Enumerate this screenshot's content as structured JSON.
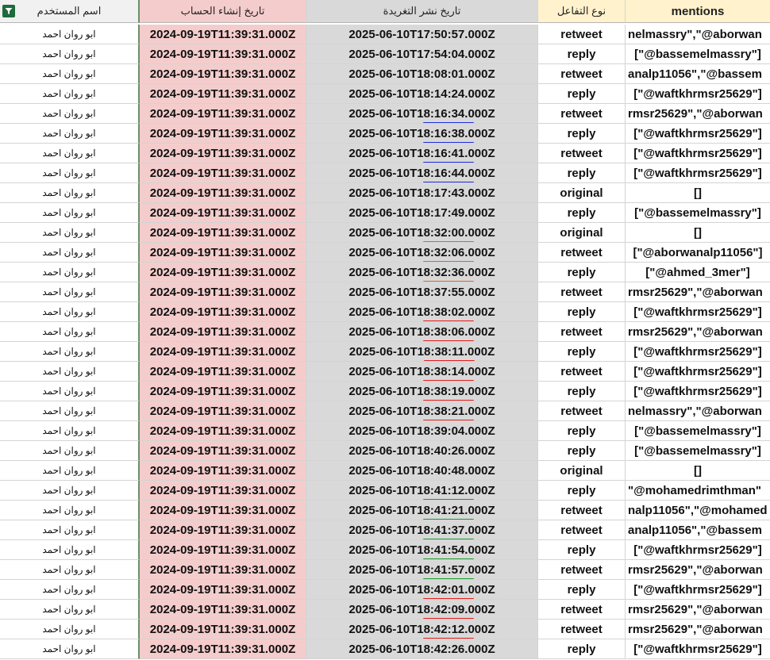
{
  "columns": {
    "user": "اسم المستخدم",
    "created": "تاريخ إنشاء الحساب",
    "published": "تاريخ نشر التغريدة",
    "type": "نوع التفاعل",
    "mentions": "mentions"
  },
  "icons": {
    "filter": "filter-icon"
  },
  "colors": {
    "created_bg": "#f4cccc",
    "published_bg": "#d9d9d9",
    "header_yellow": "#fff2cc",
    "underline_blue": "#1d2ce0",
    "underline_orange": "#f0620f",
    "underline_red": "#e81c1c",
    "underline_green": "#1a9a2a"
  },
  "rows": [
    {
      "user": "ابو روان احمد",
      "created": "2024-09-19T11:39:31.000Z",
      "published": "2025-06-10T17:50:57.000Z",
      "type": "retweet",
      "mentions": "nelmassry\",\"@aborwan",
      "underline": ""
    },
    {
      "user": "ابو روان احمد",
      "created": "2024-09-19T11:39:31.000Z",
      "published": "2025-06-10T17:54:04.000Z",
      "type": "reply",
      "mentions": "[\"@bassemelmassry\"]",
      "underline": ""
    },
    {
      "user": "ابو روان احمد",
      "created": "2024-09-19T11:39:31.000Z",
      "published": "2025-06-10T18:08:01.000Z",
      "type": "retweet",
      "mentions": "analp11056\",\"@bassem",
      "underline": ""
    },
    {
      "user": "ابو روان احمد",
      "created": "2024-09-19T11:39:31.000Z",
      "published": "2025-06-10T18:14:24.000Z",
      "type": "reply",
      "mentions": "[\"@waftkhrmsr25629\"]",
      "underline": ""
    },
    {
      "user": "ابو روان احمد",
      "created": "2024-09-19T11:39:31.000Z",
      "published": "2025-06-10T18:16:34.000Z",
      "type": "retweet",
      "mentions": "rmsr25629\",\"@aborwan",
      "underline": "blue"
    },
    {
      "user": "ابو روان احمد",
      "created": "2024-09-19T11:39:31.000Z",
      "published": "2025-06-10T18:16:38.000Z",
      "type": "reply",
      "mentions": "[\"@waftkhrmsr25629\"]",
      "underline": "blue"
    },
    {
      "user": "ابو روان احمد",
      "created": "2024-09-19T11:39:31.000Z",
      "published": "2025-06-10T18:16:41.000Z",
      "type": "retweet",
      "mentions": "[\"@waftkhrmsr25629\"]",
      "underline": "blue"
    },
    {
      "user": "ابو روان احمد",
      "created": "2024-09-19T11:39:31.000Z",
      "published": "2025-06-10T18:16:44.000Z",
      "type": "reply",
      "mentions": "[\"@waftkhrmsr25629\"]",
      "underline": "blue"
    },
    {
      "user": "ابو روان احمد",
      "created": "2024-09-19T11:39:31.000Z",
      "published": "2025-06-10T18:17:43.000Z",
      "type": "original",
      "mentions": "[]",
      "underline": ""
    },
    {
      "user": "ابو روان احمد",
      "created": "2024-09-19T11:39:31.000Z",
      "published": "2025-06-10T18:17:49.000Z",
      "type": "reply",
      "mentions": "[\"@bassemelmassry\"]",
      "underline": ""
    },
    {
      "user": "ابو روان احمد",
      "created": "2024-09-19T11:39:31.000Z",
      "published": "2025-06-10T18:32:00.000Z",
      "type": "original",
      "mentions": "[]",
      "underline": "orange"
    },
    {
      "user": "ابو روان احمد",
      "created": "2024-09-19T11:39:31.000Z",
      "published": "2025-06-10T18:32:06.000Z",
      "type": "retweet",
      "mentions": "[\"@aborwanalp11056\"]",
      "underline": "orange"
    },
    {
      "user": "ابو روان احمد",
      "created": "2024-09-19T11:39:31.000Z",
      "published": "2025-06-10T18:32:36.000Z",
      "type": "reply",
      "mentions": "[\"@ahmed_3mer\"]",
      "underline": "orange"
    },
    {
      "user": "ابو روان احمد",
      "created": "2024-09-19T11:39:31.000Z",
      "published": "2025-06-10T18:37:55.000Z",
      "type": "retweet",
      "mentions": "rmsr25629\",\"@aborwan",
      "underline": ""
    },
    {
      "user": "ابو روان احمد",
      "created": "2024-09-19T11:39:31.000Z",
      "published": "2025-06-10T18:38:02.000Z",
      "type": "reply",
      "mentions": "[\"@waftkhrmsr25629\"]",
      "underline": "red"
    },
    {
      "user": "ابو روان احمد",
      "created": "2024-09-19T11:39:31.000Z",
      "published": "2025-06-10T18:38:06.000Z",
      "type": "retweet",
      "mentions": "rmsr25629\",\"@aborwan",
      "underline": "red"
    },
    {
      "user": "ابو روان احمد",
      "created": "2024-09-19T11:39:31.000Z",
      "published": "2025-06-10T18:38:11.000Z",
      "type": "reply",
      "mentions": "[\"@waftkhrmsr25629\"]",
      "underline": "red"
    },
    {
      "user": "ابو روان احمد",
      "created": "2024-09-19T11:39:31.000Z",
      "published": "2025-06-10T18:38:14.000Z",
      "type": "retweet",
      "mentions": "[\"@waftkhrmsr25629\"]",
      "underline": "red"
    },
    {
      "user": "ابو روان احمد",
      "created": "2024-09-19T11:39:31.000Z",
      "published": "2025-06-10T18:38:19.000Z",
      "type": "reply",
      "mentions": "[\"@waftkhrmsr25629\"]",
      "underline": "red"
    },
    {
      "user": "ابو روان احمد",
      "created": "2024-09-19T11:39:31.000Z",
      "published": "2025-06-10T18:38:21.000Z",
      "type": "retweet",
      "mentions": "nelmassry\",\"@aborwan",
      "underline": "red"
    },
    {
      "user": "ابو روان احمد",
      "created": "2024-09-19T11:39:31.000Z",
      "published": "2025-06-10T18:39:04.000Z",
      "type": "reply",
      "mentions": "[\"@bassemelmassry\"]",
      "underline": ""
    },
    {
      "user": "ابو روان احمد",
      "created": "2024-09-19T11:39:31.000Z",
      "published": "2025-06-10T18:40:26.000Z",
      "type": "reply",
      "mentions": "[\"@bassemelmassry\"]",
      "underline": ""
    },
    {
      "user": "ابو روان احمد",
      "created": "2024-09-19T11:39:31.000Z",
      "published": "2025-06-10T18:40:48.000Z",
      "type": "original",
      "mentions": "[]",
      "underline": ""
    },
    {
      "user": "ابو روان احمد",
      "created": "2024-09-19T11:39:31.000Z",
      "published": "2025-06-10T18:41:12.000Z",
      "type": "reply",
      "mentions": "\"@mohamedrimthman\"",
      "underline": "green"
    },
    {
      "user": "ابو روان احمد",
      "created": "2024-09-19T11:39:31.000Z",
      "published": "2025-06-10T18:41:21.000Z",
      "type": "retweet",
      "mentions": "nalp11056\",\"@mohamed",
      "underline": "green"
    },
    {
      "user": "ابو روان احمد",
      "created": "2024-09-19T11:39:31.000Z",
      "published": "2025-06-10T18:41:37.000Z",
      "type": "retweet",
      "mentions": "analp11056\",\"@bassem",
      "underline": "green"
    },
    {
      "user": "ابو روان احمد",
      "created": "2024-09-19T11:39:31.000Z",
      "published": "2025-06-10T18:41:54.000Z",
      "type": "reply",
      "mentions": "[\"@waftkhrmsr25629\"]",
      "underline": "green"
    },
    {
      "user": "ابو روان احمد",
      "created": "2024-09-19T11:39:31.000Z",
      "published": "2025-06-10T18:41:57.000Z",
      "type": "retweet",
      "mentions": "rmsr25629\",\"@aborwan",
      "underline": "green"
    },
    {
      "user": "ابو روان احمد",
      "created": "2024-09-19T11:39:31.000Z",
      "published": "2025-06-10T18:42:01.000Z",
      "type": "reply",
      "mentions": "[\"@waftkhrmsr25629\"]",
      "underline": "red"
    },
    {
      "user": "ابو روان احمد",
      "created": "2024-09-19T11:39:31.000Z",
      "published": "2025-06-10T18:42:09.000Z",
      "type": "retweet",
      "mentions": "rmsr25629\",\"@aborwan",
      "underline": "red"
    },
    {
      "user": "ابو روان احمد",
      "created": "2024-09-19T11:39:31.000Z",
      "published": "2025-06-10T18:42:12.000Z",
      "type": "retweet",
      "mentions": "rmsr25629\",\"@aborwan",
      "underline": "red"
    },
    {
      "user": "ابو روان احمد",
      "created": "2024-09-19T11:39:31.000Z",
      "published": "2025-06-10T18:42:26.000Z",
      "type": "reply",
      "mentions": "[\"@waftkhrmsr25629\"]",
      "underline": ""
    }
  ]
}
